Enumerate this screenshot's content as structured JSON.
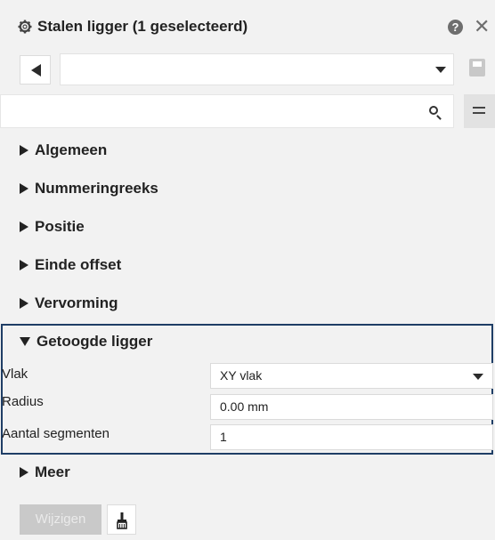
{
  "header": {
    "title": "Stalen ligger (1 geselecteerd)",
    "help_glyph": "?",
    "close_glyph": "✕"
  },
  "toolbar": {
    "preset_value": ""
  },
  "search": {
    "placeholder": "",
    "value": ""
  },
  "sections": {
    "algemeen": "Algemeen",
    "nummeringreeks": "Nummeringreeks",
    "positie": "Positie",
    "einde_offset": "Einde offset",
    "vervorming": "Vervorming",
    "getoogde_ligger": "Getoogde ligger",
    "meer": "Meer"
  },
  "properties": {
    "vlak_label": "Vlak",
    "vlak_value": "XY vlak",
    "radius_label": "Radius",
    "radius_value": "0.00 mm",
    "segmenten_label": "Aantal segmenten",
    "segmenten_value": "1"
  },
  "footer": {
    "wijzigen_label": "Wijzigen"
  },
  "colors": {
    "highlight_border": "#1f3e66",
    "panel_background": "#f2f2f2",
    "disabled_button": "#c9c9c9"
  },
  "icons": [
    "gear-icon",
    "help-icon",
    "close-icon",
    "back-arrow-icon",
    "save-icon",
    "search-icon",
    "menu-icon",
    "brush-icon"
  ]
}
